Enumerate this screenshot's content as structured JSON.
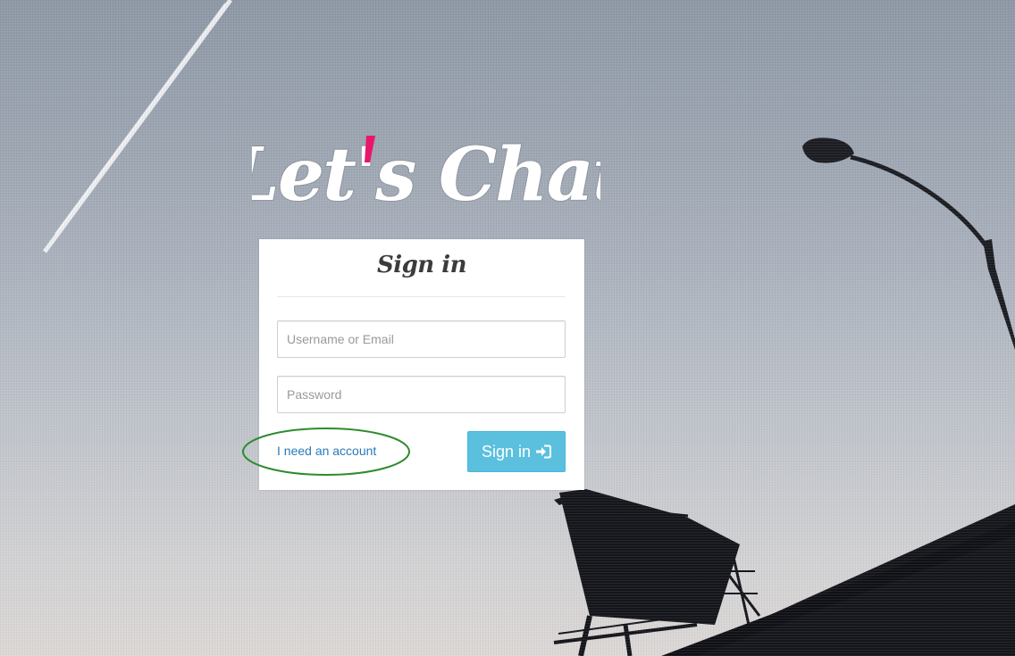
{
  "app": {
    "logo_text": "Let's Chat",
    "logo_accent_color": "#e8176b"
  },
  "signin_card": {
    "title": "Sign in",
    "username_placeholder": "Username or Email",
    "password_placeholder": "Password",
    "account_link_label": "I need an account",
    "submit_label": "Sign in",
    "submit_icon": "sign-in-icon",
    "submit_color": "#5bc0de"
  },
  "annotation": {
    "highlight_color": "#2e8b2e"
  }
}
